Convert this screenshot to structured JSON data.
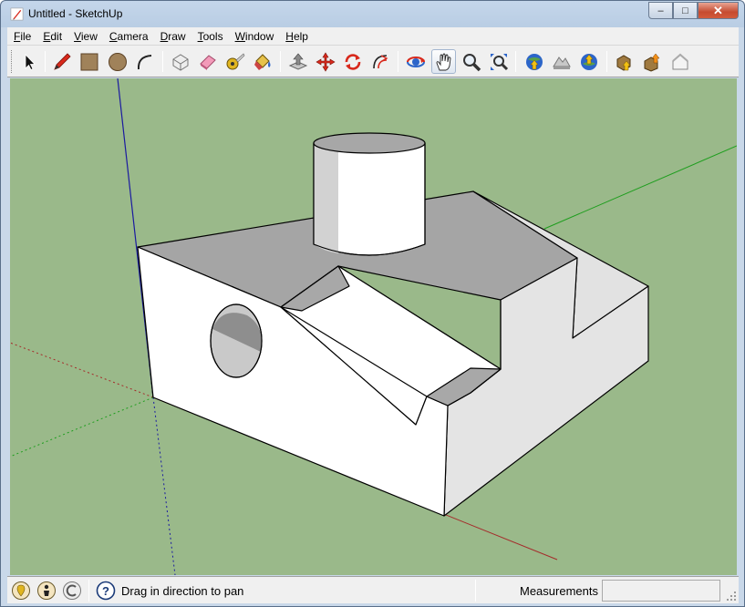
{
  "window": {
    "title": "Untitled - SketchUp",
    "minimize_symbol": "–",
    "maximize_symbol": "□",
    "close_symbol": "✕"
  },
  "menubar": {
    "items": [
      {
        "underline": "F",
        "rest": "ile"
      },
      {
        "underline": "E",
        "rest": "dit"
      },
      {
        "underline": "V",
        "rest": "iew"
      },
      {
        "underline": "C",
        "rest": "amera"
      },
      {
        "underline": "D",
        "rest": "raw"
      },
      {
        "underline": "T",
        "rest": "ools"
      },
      {
        "underline": "W",
        "rest": "indow"
      },
      {
        "underline": "H",
        "rest": "elp"
      }
    ]
  },
  "toolbar": {
    "tools": [
      "select-icon",
      "pencil-icon",
      "rectangle-icon",
      "circle-icon",
      "arc-icon",
      "make-component-icon",
      "eraser-icon",
      "tape-measure-icon",
      "paint-bucket-icon",
      "push-pull-icon",
      "move-icon",
      "rotate-icon",
      "offset-icon",
      "orbit-icon",
      "pan-icon",
      "zoom-icon",
      "zoom-extents-icon",
      "get-current-view-icon",
      "toggle-terrain-icon",
      "place-model-icon",
      "get-models-icon",
      "share-model-icon",
      "share-component-icon"
    ],
    "active_tool": "pan-icon"
  },
  "viewport": {
    "background_color": "#9ab98a",
    "axis_colors": {
      "red": "#a52a2a",
      "green": "#1e9e1e",
      "blue": "#1a1aa0"
    }
  },
  "statusbar": {
    "message": "Drag in direction to pan",
    "measurements_label": "Measurements",
    "measurements_value": ""
  }
}
